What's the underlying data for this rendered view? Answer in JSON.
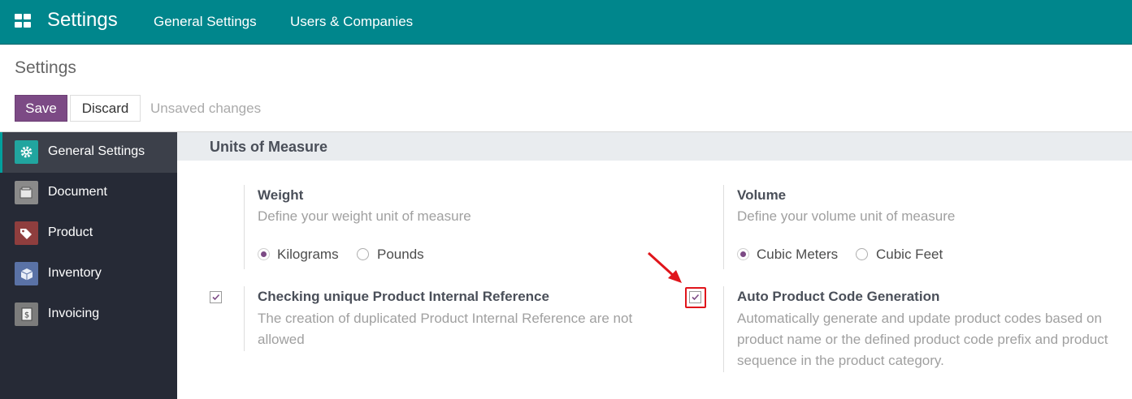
{
  "navbar": {
    "apps_icon": "apps-grid-icon",
    "title": "Settings",
    "links": [
      "General Settings",
      "Users & Companies"
    ]
  },
  "control_panel": {
    "breadcrumb": "Settings",
    "save_label": "Save",
    "discard_label": "Discard",
    "status": "Unsaved changes"
  },
  "sidebar": {
    "items": [
      {
        "label": "General Settings",
        "icon": "gear-icon",
        "color": "#21a59f",
        "active": true
      },
      {
        "label": "Document",
        "icon": "document-icon",
        "color": "#8a8a8a",
        "active": false
      },
      {
        "label": "Product",
        "icon": "tags-icon",
        "color": "#8f3e3e",
        "active": false
      },
      {
        "label": "Inventory",
        "icon": "box-icon",
        "color": "#5a72a6",
        "active": false
      },
      {
        "label": "Invoicing",
        "icon": "invoice-icon",
        "color": "#7c7c7c",
        "active": false
      }
    ]
  },
  "section": {
    "title": "Units of Measure"
  },
  "settings": {
    "weight": {
      "title": "Weight",
      "description": "Define your weight unit of measure",
      "options": [
        "Kilograms",
        "Pounds"
      ],
      "selected": "Kilograms"
    },
    "volume": {
      "title": "Volume",
      "description": "Define your volume unit of measure",
      "options": [
        "Cubic Meters",
        "Cubic Feet"
      ],
      "selected": "Cubic Meters"
    },
    "unique_reference": {
      "title": "Checking unique Product Internal Reference",
      "description_lines": [
        "The creation of duplicated Product Internal Reference are not",
        "allowed"
      ],
      "checked": true
    },
    "auto_code": {
      "title": "Auto Product Code Generation",
      "description_lines": [
        "Automatically generate and update product codes based on",
        "product name or the defined product code prefix and product",
        "sequence in the product category."
      ],
      "checked": true
    }
  },
  "colors": {
    "navbar": "#00868c",
    "primary_button": "#7c4a85",
    "sidebar": "#262a36",
    "highlight": "#e0151b"
  }
}
